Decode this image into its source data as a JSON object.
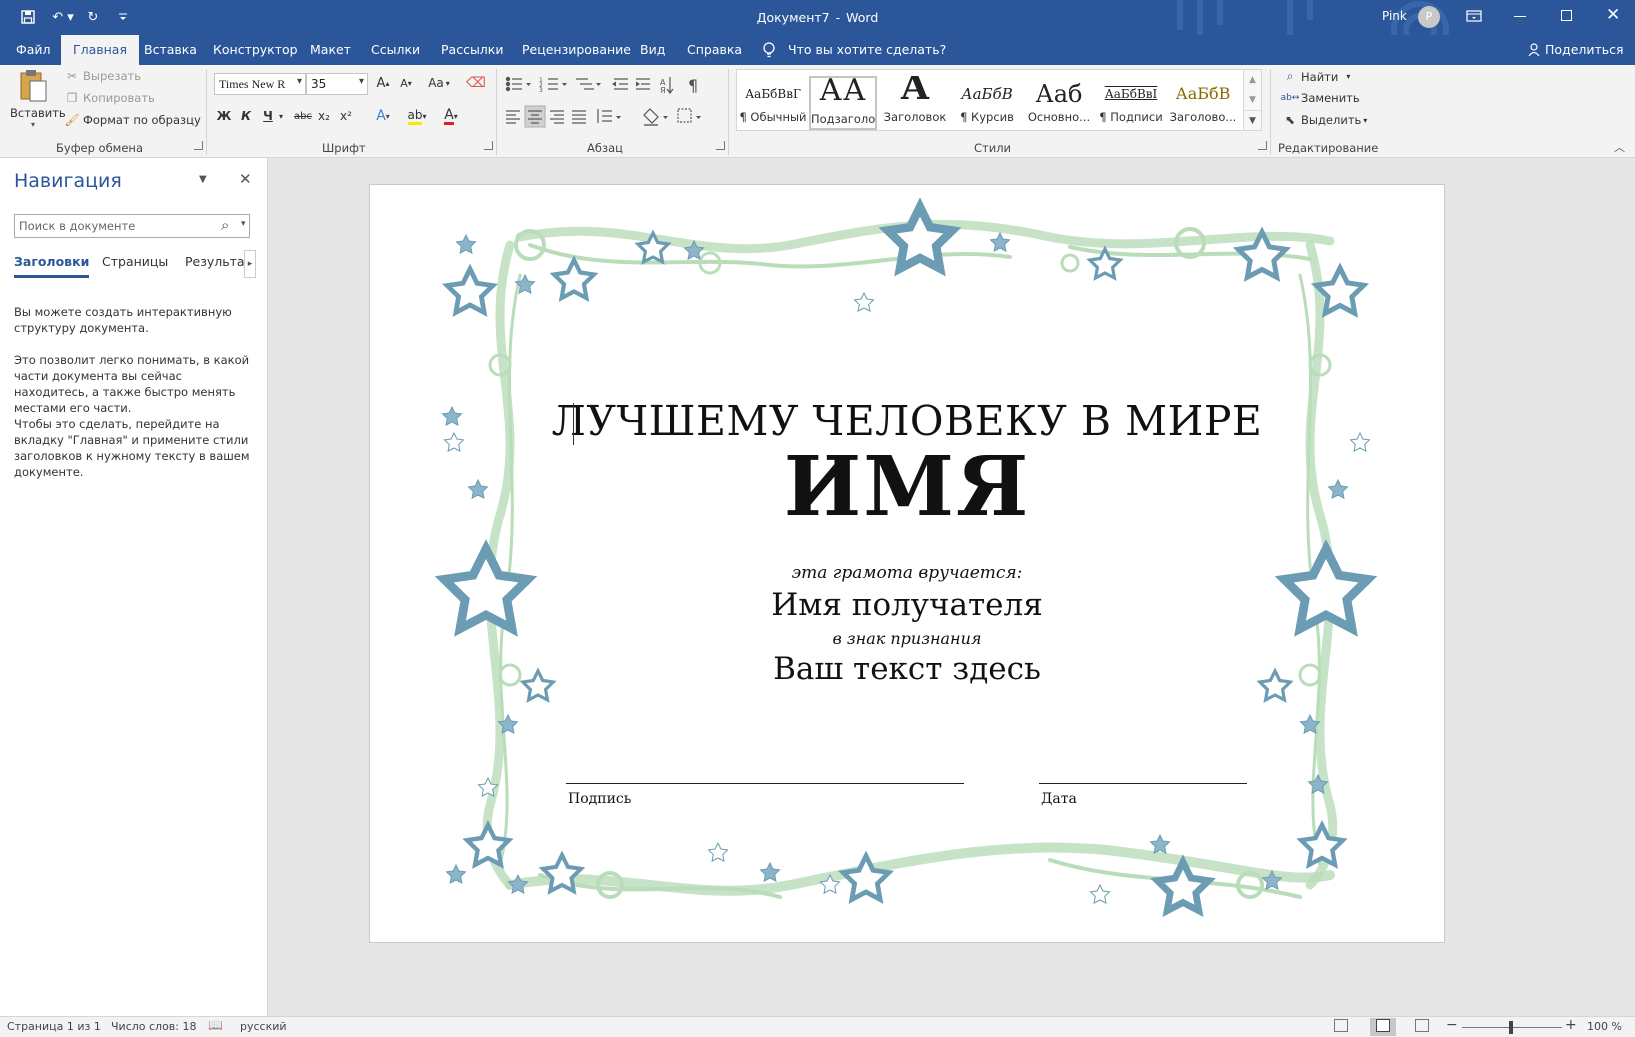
{
  "window": {
    "title": "Документ7",
    "app_name": "Word",
    "user_name": "Pink",
    "user_initial": "P"
  },
  "ribbon_tabs": {
    "file": "Файл",
    "home": "Главная",
    "insert": "Вставка",
    "design": "Конструктор",
    "layout": "Макет",
    "references": "Ссылки",
    "mailings": "Рассылки",
    "review": "Рецензирование",
    "view": "Вид",
    "help": "Справка",
    "tell_me": "Что вы хотите сделать?",
    "share": "Поделиться"
  },
  "clipboard": {
    "paste": "Вставить",
    "cut": "Вырезать",
    "copy": "Копировать",
    "format_painter": "Формат по образцу",
    "label": "Буфер обмена"
  },
  "font": {
    "name": "Times New R",
    "size": "35",
    "label": "Шрифт",
    "bold": "Ж",
    "italic": "К",
    "underline": "Ч",
    "strikethrough": "abc",
    "subscript": "x₂",
    "superscript": "x²",
    "change_case": "Aa"
  },
  "paragraph": {
    "label": "Абзац"
  },
  "styles": {
    "label": "Стили",
    "items": [
      {
        "sample": "АаБбВвГ",
        "name": "¶ Обычный"
      },
      {
        "sample": "АА",
        "name": "Подзаголо..."
      },
      {
        "sample": "А",
        "name": "Заголовок"
      },
      {
        "sample": "АаБбВ",
        "name": "¶ Курсив"
      },
      {
        "sample": "Ааб",
        "name": "Основно..."
      },
      {
        "sample": "АаБбВвI",
        "name": "¶ Подписи"
      },
      {
        "sample": "АаБбВ",
        "name": "Заголово..."
      }
    ]
  },
  "editing": {
    "find": "Найти",
    "replace": "Заменить",
    "select": "Выделить",
    "label": "Редактирование"
  },
  "navigation": {
    "title": "Навигация",
    "search_placeholder": "Поиск в документе",
    "tabs": [
      "Заголовки",
      "Страницы",
      "Результать"
    ],
    "info1": "Вы можете создать интерактивную структуру документа.",
    "info2": "Это позволит легко понимать, в какой части документа вы сейчас находитесь, а также быстро менять местами его части.",
    "info3": "Чтобы это сделать, перейдите на вкладку \"Главная\" и примените стили заголовков к нужному тексту в вашем документе."
  },
  "certificate": {
    "headline": "ЛУЧШЕМУ ЧЕЛОВЕКУ В МИРЕ",
    "name": "ИМЯ",
    "presented_to": "эта грамота вручается:",
    "recipient": "Имя получателя",
    "in_recognition": "в знак признания",
    "your_text": "Ваш текст здесь",
    "signature_label": "Подпись",
    "date_label": "Дата"
  },
  "status": {
    "page": "Страница 1 из 1",
    "words": "Число слов: 18",
    "language": "русский",
    "zoom": "100 %"
  },
  "colors": {
    "accent": "#2b579a",
    "star_blue": "#8db5c9",
    "swirl_green": "#b9dcb9"
  }
}
